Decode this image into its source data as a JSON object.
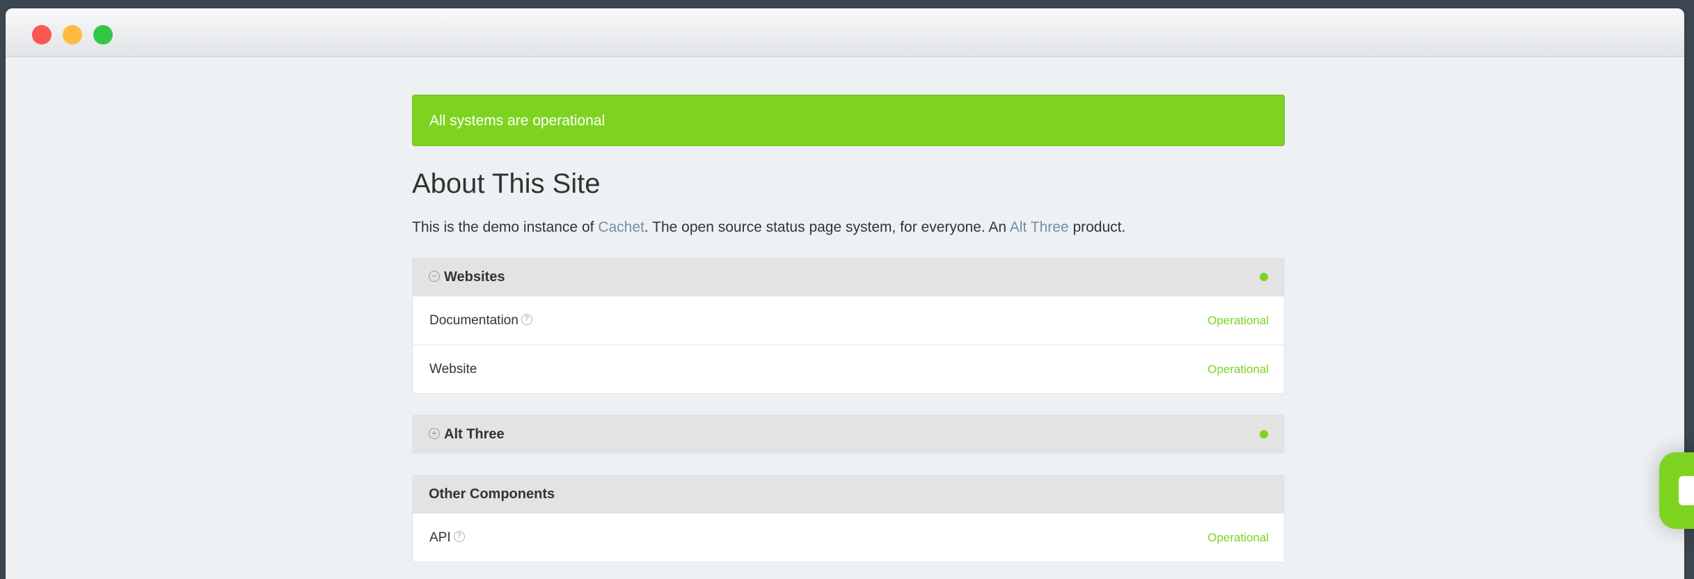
{
  "banner": {
    "text": "All systems are operational",
    "color": "#7ed321"
  },
  "about": {
    "title": "About This Site",
    "text_before": "This is the demo instance of ",
    "link1": "Cachet",
    "text_middle": ". The open source status page system, for everyone. An ",
    "link2": "Alt Three",
    "text_after": " product."
  },
  "groups": [
    {
      "name": "Websites",
      "toggle": "⊖",
      "status_color": "#7ed321",
      "components": [
        {
          "name": "Documentation",
          "status": "Operational",
          "has_help": true
        },
        {
          "name": "Website",
          "status": "Operational",
          "has_help": false
        }
      ]
    },
    {
      "name": "Alt Three",
      "toggle": "⊕",
      "status_color": "#7ed321",
      "components": []
    },
    {
      "name": "Other Components",
      "components": [
        {
          "name": "API",
          "status": "Operational",
          "has_help": true
        }
      ]
    }
  ],
  "icons": {
    "help": "question-circle-icon",
    "collapse": "minus-circle-icon",
    "expand": "plus-circle-icon"
  },
  "colors": {
    "operational": "#7ed321",
    "link": "#6f8fab",
    "background": "#eef1f3"
  }
}
